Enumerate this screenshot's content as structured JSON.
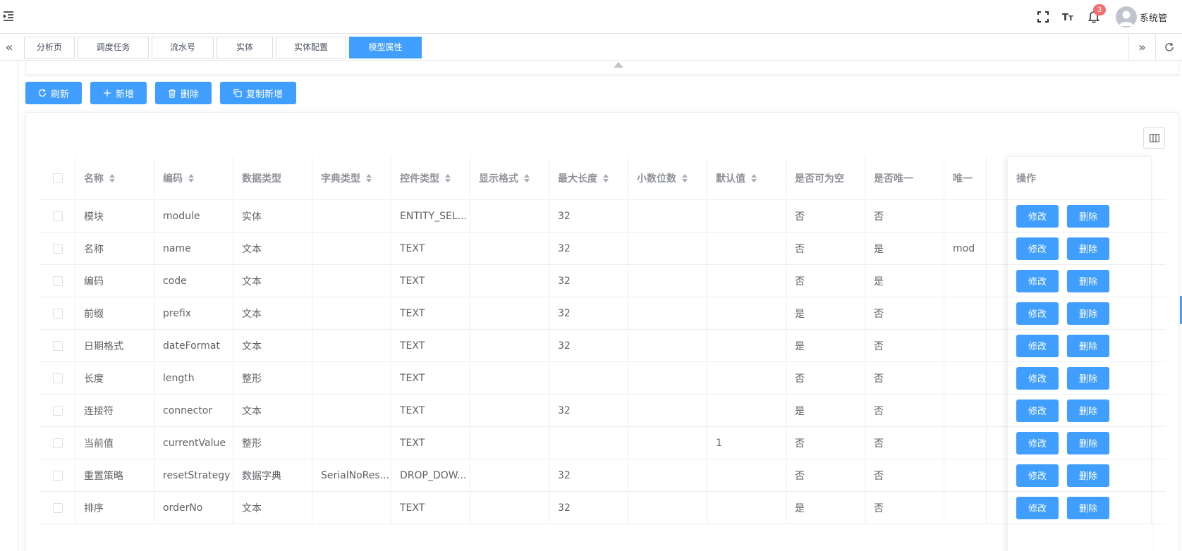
{
  "header": {
    "menu_toggle_icon": "indent-icon",
    "notification_count": "3",
    "username": "系统管",
    "icons": [
      "fullscreen-icon",
      "font-size-icon",
      "bell-icon",
      "avatar"
    ]
  },
  "tags": [
    {
      "label": "分析页",
      "active": false
    },
    {
      "label": "调度任务",
      "active": false
    },
    {
      "label": "流水号",
      "active": false
    },
    {
      "label": "实体",
      "active": false
    },
    {
      "label": "实体配置",
      "active": false
    },
    {
      "label": "模型属性",
      "active": true
    }
  ],
  "toolbar": {
    "refresh": "刷新",
    "add": "新增",
    "delete": "删除",
    "copy_add": "复制新增"
  },
  "table": {
    "columns": [
      {
        "label": "名称",
        "sortable": true
      },
      {
        "label": "编码",
        "sortable": true
      },
      {
        "label": "数据类型",
        "sortable": false
      },
      {
        "label": "字典类型",
        "sortable": true
      },
      {
        "label": "控件类型",
        "sortable": true
      },
      {
        "label": "显示格式",
        "sortable": true
      },
      {
        "label": "最大长度",
        "sortable": true
      },
      {
        "label": "小数位数",
        "sortable": true
      },
      {
        "label": "默认值",
        "sortable": true
      },
      {
        "label": "是否可为空",
        "sortable": false
      },
      {
        "label": "是否唯一",
        "sortable": false
      },
      {
        "label": "唯一",
        "sortable": false
      }
    ],
    "action_header": "操作",
    "edit_label": "修改",
    "delete_label": "删除",
    "rows": [
      [
        "模块",
        "module",
        "实体",
        "",
        "ENTITY_SEL...",
        "",
        "32",
        "",
        "",
        "否",
        "否",
        ""
      ],
      [
        "名称",
        "name",
        "文本",
        "",
        "TEXT",
        "",
        "32",
        "",
        "",
        "否",
        "是",
        "mod"
      ],
      [
        "编码",
        "code",
        "文本",
        "",
        "TEXT",
        "",
        "32",
        "",
        "",
        "否",
        "是",
        ""
      ],
      [
        "前缀",
        "prefix",
        "文本",
        "",
        "TEXT",
        "",
        "32",
        "",
        "",
        "是",
        "否",
        ""
      ],
      [
        "日期格式",
        "dateFormat",
        "文本",
        "",
        "TEXT",
        "",
        "32",
        "",
        "",
        "是",
        "否",
        ""
      ],
      [
        "长度",
        "length",
        "整形",
        "",
        "TEXT",
        "",
        "",
        "",
        "",
        "否",
        "否",
        ""
      ],
      [
        "连接符",
        "connector",
        "文本",
        "",
        "TEXT",
        "",
        "32",
        "",
        "",
        "是",
        "否",
        ""
      ],
      [
        "当前值",
        "currentValue",
        "整形",
        "",
        "TEXT",
        "",
        "",
        "",
        "1",
        "否",
        "否",
        ""
      ],
      [
        "重置策略",
        "resetStrategy",
        "数据字典",
        "SerialNoRes...",
        "DROP_DOW...",
        "",
        "32",
        "",
        "",
        "否",
        "否",
        ""
      ],
      [
        "排序",
        "orderNo",
        "文本",
        "",
        "TEXT",
        "",
        "32",
        "",
        "",
        "是",
        "否",
        ""
      ]
    ]
  },
  "colors": {
    "primary": "#409eff",
    "badge": "#f56c6c",
    "border": "#ebeef5"
  }
}
